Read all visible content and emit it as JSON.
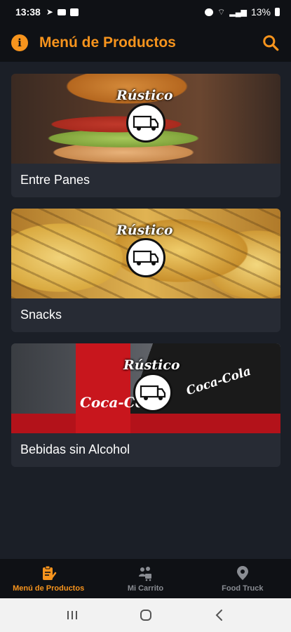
{
  "status_bar": {
    "time": "13:38",
    "battery": "13%"
  },
  "header": {
    "title": "Menú de Productos",
    "info_icon": "info-icon",
    "search_icon": "search-icon"
  },
  "brand": {
    "logo_text": "Rústico"
  },
  "categories": [
    {
      "label": "Entre Panes",
      "image": "burger"
    },
    {
      "label": "Snacks",
      "image": "potato-wedges"
    },
    {
      "label": "Bebidas sin Alcohol",
      "image": "coca-cola",
      "image_text": "Coca-Cola"
    }
  ],
  "bottom_nav": [
    {
      "label": "Menú de Productos",
      "icon": "menu-clipboard-icon",
      "active": true
    },
    {
      "label": "Mi Carrito",
      "icon": "cart-people-icon",
      "active": false
    },
    {
      "label": "Food Truck",
      "icon": "location-pin-icon",
      "active": false
    }
  ],
  "colors": {
    "accent": "#f7941d",
    "background": "#1b1f27",
    "card": "#272b34",
    "header": "#0f1115",
    "inactive": "#8a8d93"
  }
}
